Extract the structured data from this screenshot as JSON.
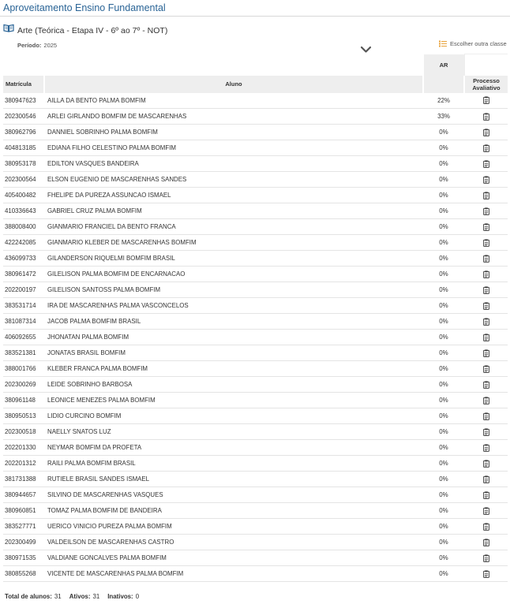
{
  "page": {
    "title": "Aproveitamento Ensino Fundamental"
  },
  "class_info": {
    "name": "Arte (Teórica - Etapa IV - 6º ao 7º - NOT)",
    "period_label": "Período:",
    "period_value": "2025",
    "choose_label": "Escolher outra classe"
  },
  "table": {
    "headers": {
      "ar": "AR",
      "matricula": "Matrícula",
      "aluno": "Aluno",
      "processo_l1": "Processo",
      "processo_l2": "Avaliativo"
    },
    "rows": [
      {
        "matricula": "380947623",
        "aluno": "AILLA DA BENTO PALMA BOMFIM",
        "ar": "22%"
      },
      {
        "matricula": "202300546",
        "aluno": "ARLEI GIRLANDO BOMFIM DE MASCARENHAS",
        "ar": "33%"
      },
      {
        "matricula": "380962796",
        "aluno": "DANNIEL SOBRINHO PALMA BOMFIM",
        "ar": "0%"
      },
      {
        "matricula": "404813185",
        "aluno": "EDIANA FILHO CELESTINO PALMA BOMFIM",
        "ar": "0%"
      },
      {
        "matricula": "380953178",
        "aluno": "EDILTON VASQUES BANDEIRA",
        "ar": "0%"
      },
      {
        "matricula": "202300564",
        "aluno": "ELSON EUGENIO DE MASCARENHAS SANDES",
        "ar": "0%"
      },
      {
        "matricula": "405400482",
        "aluno": "FHELIPE DA PUREZA ASSUNCAO ISMAEL",
        "ar": "0%"
      },
      {
        "matricula": "410336643",
        "aluno": "GABRIEL CRUZ PALMA BOMFIM",
        "ar": "0%"
      },
      {
        "matricula": "388008400",
        "aluno": "GIANMARIO FRANCIEL DA BENTO FRANCA",
        "ar": "0%"
      },
      {
        "matricula": "422242085",
        "aluno": "GIANMARIO KLEBER DE MASCARENHAS BOMFIM",
        "ar": "0%"
      },
      {
        "matricula": "436099733",
        "aluno": "GILANDERSON RIQUELMI BOMFIM BRASIL",
        "ar": "0%"
      },
      {
        "matricula": "380961472",
        "aluno": "GILELISON PALMA BOMFIM DE ENCARNACAO",
        "ar": "0%"
      },
      {
        "matricula": "202200197",
        "aluno": "GILELISON SANTOSS PALMA BOMFIM",
        "ar": "0%"
      },
      {
        "matricula": "383531714",
        "aluno": "IRA DE MASCARENHAS PALMA VASCONCELOS",
        "ar": "0%"
      },
      {
        "matricula": "381087314",
        "aluno": "JACOB PALMA BOMFIM BRASIL",
        "ar": "0%"
      },
      {
        "matricula": "406092655",
        "aluno": "JHONATAN PALMA BOMFIM",
        "ar": "0%"
      },
      {
        "matricula": "383521381",
        "aluno": "JONATAS BRASIL BOMFIM",
        "ar": "0%"
      },
      {
        "matricula": "388001766",
        "aluno": "KLEBER FRANCA PALMA BOMFIM",
        "ar": "0%"
      },
      {
        "matricula": "202300269",
        "aluno": "LEIDE SOBRINHO BARBOSA",
        "ar": "0%"
      },
      {
        "matricula": "380961148",
        "aluno": "LEONICE MENEZES PALMA BOMFIM",
        "ar": "0%"
      },
      {
        "matricula": "380950513",
        "aluno": "LIDIO CURCINO BOMFIM",
        "ar": "0%"
      },
      {
        "matricula": "202300518",
        "aluno": "NAELLY SNATOS LUZ",
        "ar": "0%"
      },
      {
        "matricula": "202201330",
        "aluno": "NEYMAR BOMFIM DA PROFETA",
        "ar": "0%"
      },
      {
        "matricula": "202201312",
        "aluno": "RAILI PALMA BOMFIM BRASIL",
        "ar": "0%"
      },
      {
        "matricula": "381731388",
        "aluno": "RUTIELE BRASIL SANDES ISMAEL",
        "ar": "0%"
      },
      {
        "matricula": "380944657",
        "aluno": "SILVINO DE MASCARENHAS VASQUES",
        "ar": "0%"
      },
      {
        "matricula": "380960851",
        "aluno": "TOMAZ PALMA BOMFIM DE BANDEIRA",
        "ar": "0%"
      },
      {
        "matricula": "383527771",
        "aluno": "UERICO VINICIO PUREZA PALMA BOMFIM",
        "ar": "0%"
      },
      {
        "matricula": "202300499",
        "aluno": "VALDEILSON DE MASCARENHAS CASTRO",
        "ar": "0%"
      },
      {
        "matricula": "380971535",
        "aluno": "VALDIANE GONCALVES PALMA BOMFIM",
        "ar": "0%"
      },
      {
        "matricula": "380855268",
        "aluno": "VICENTE DE MASCARENHAS PALMA BOMFIM",
        "ar": "0%"
      }
    ]
  },
  "footer": {
    "total_label": "Total de alunos:",
    "total_value": "31",
    "ativos_label": "Ativos:",
    "ativos_value": "31",
    "inativos_label": "Inativos:",
    "inativos_value": "0"
  },
  "icons": {
    "book": "book-icon",
    "chevron": "chevron-down-icon",
    "list": "list-icon",
    "clipboard": "clipboard-icon"
  },
  "colors": {
    "title_blue": "#2a6496",
    "header_bg": "#eeeeee",
    "accent_orange": "#e8a33d"
  }
}
